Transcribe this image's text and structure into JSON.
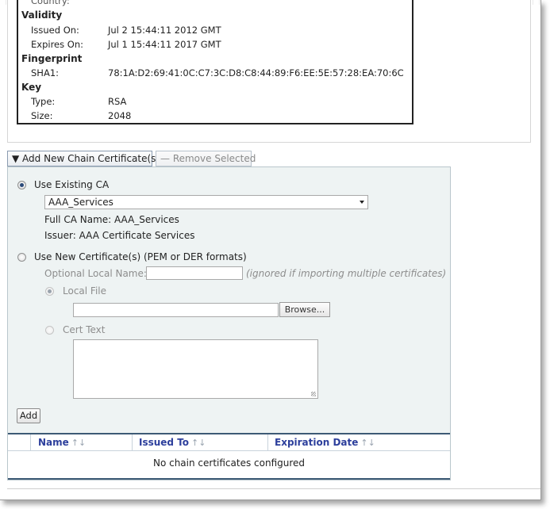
{
  "certificate": {
    "cut_label": "Country:",
    "validity": {
      "heading": "Validity",
      "issued_on_label": "Issued On:",
      "issued_on": "Jul 2 15:44:11 2012 GMT",
      "expires_on_label": "Expires On:",
      "expires_on": "Jul 1 15:44:11 2017 GMT"
    },
    "fingerprint": {
      "heading": "Fingerprint",
      "sha1_label": "SHA1:",
      "sha1": "78:1A:D2:69:41:0C:C7:3C:D8:C8:44:89:F6:EE:5E:57:28:EA:70:6C"
    },
    "key": {
      "heading": "Key",
      "type_label": "Type:",
      "type": "RSA",
      "size_label": "Size:",
      "size": "2048"
    }
  },
  "toolbar": {
    "add_chain_label": "▼ Add New Chain Certificate(s)",
    "remove_selected_label": "— Remove Selected"
  },
  "chain_form": {
    "use_existing_label": "Use Existing CA",
    "selected_ca": "AAA_Services",
    "full_ca_name": "Full CA Name: AAA_Services",
    "issuer": "Issuer: AAA Certificate Services",
    "use_new_label": "Use New Certificate(s) (PEM or DER formats)",
    "optional_name_label": "Optional Local Name:",
    "optional_name_value": "",
    "optional_name_hint": "(ignored if importing multiple certificates)",
    "local_file_label": "Local File",
    "local_file_value": "",
    "browse_label": "Browse...",
    "cert_text_label": "Cert Text",
    "cert_text_value": "",
    "add_label": "Add"
  },
  "table": {
    "columns": [
      "Name",
      "Issued To",
      "Expiration Date"
    ],
    "sort_glyph": "↑↓",
    "empty_message": "No chain certificates configured"
  }
}
